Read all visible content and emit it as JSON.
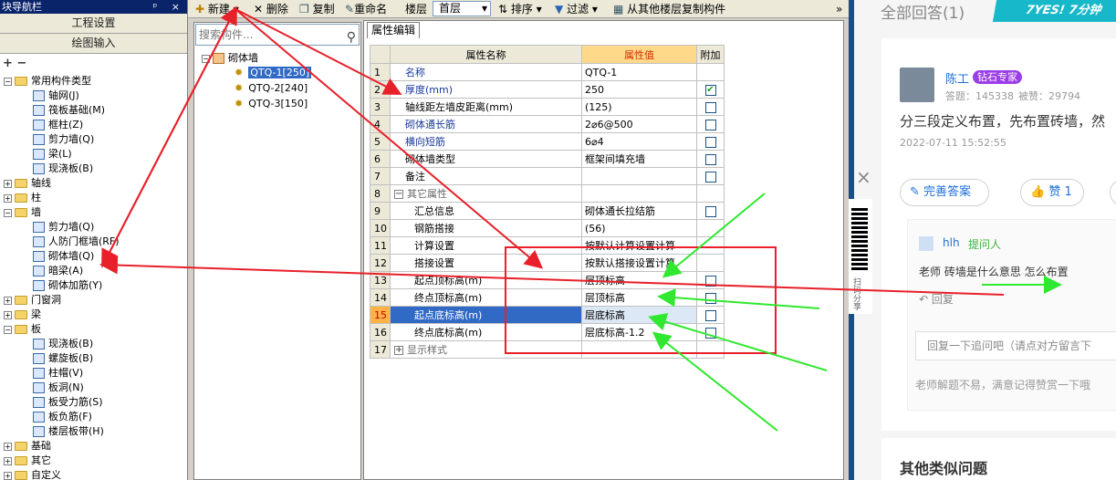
{
  "left_panel": {
    "title": "块导航栏",
    "title_buttons": "ᵖ ×",
    "mode1": "工程设置",
    "mode2": "绘图输入",
    "plusminus": "+ −",
    "tree": [
      {
        "label": "常用构件类型",
        "level": 0,
        "type": "folder",
        "exp": "−"
      },
      {
        "label": "轴网(J)",
        "level": 1,
        "type": "item"
      },
      {
        "label": "筏板基础(M)",
        "level": 1,
        "type": "item"
      },
      {
        "label": "框柱(Z)",
        "level": 1,
        "type": "item"
      },
      {
        "label": "剪力墙(Q)",
        "level": 1,
        "type": "item"
      },
      {
        "label": "梁(L)",
        "level": 1,
        "type": "item"
      },
      {
        "label": "现浇板(B)",
        "level": 1,
        "type": "item"
      },
      {
        "label": "轴线",
        "level": 0,
        "type": "folder",
        "exp": "+"
      },
      {
        "label": "柱",
        "level": 0,
        "type": "folder",
        "exp": "+"
      },
      {
        "label": "墙",
        "level": 0,
        "type": "folder",
        "exp": "−"
      },
      {
        "label": "剪力墙(Q)",
        "level": 1,
        "type": "item"
      },
      {
        "label": "人防门框墙(RF)",
        "level": 1,
        "type": "item"
      },
      {
        "label": "砌体墙(Q)",
        "level": 1,
        "type": "item"
      },
      {
        "label": "暗梁(A)",
        "level": 1,
        "type": "item"
      },
      {
        "label": "砌体加筋(Y)",
        "level": 1,
        "type": "item"
      },
      {
        "label": "门窗洞",
        "level": 0,
        "type": "folder",
        "exp": "+"
      },
      {
        "label": "梁",
        "level": 0,
        "type": "folder",
        "exp": "+"
      },
      {
        "label": "板",
        "level": 0,
        "type": "folder",
        "exp": "−"
      },
      {
        "label": "现浇板(B)",
        "level": 1,
        "type": "item"
      },
      {
        "label": "螺旋板(B)",
        "level": 1,
        "type": "item"
      },
      {
        "label": "柱帽(V)",
        "level": 1,
        "type": "item"
      },
      {
        "label": "板洞(N)",
        "level": 1,
        "type": "item"
      },
      {
        "label": "板受力筋(S)",
        "level": 1,
        "type": "item"
      },
      {
        "label": "板负筋(F)",
        "level": 1,
        "type": "item"
      },
      {
        "label": "楼层板带(H)",
        "level": 1,
        "type": "item"
      },
      {
        "label": "基础",
        "level": 0,
        "type": "folder",
        "exp": "+"
      },
      {
        "label": "其它",
        "level": 0,
        "type": "folder",
        "exp": "+"
      },
      {
        "label": "自定义",
        "level": 0,
        "type": "folder",
        "exp": "+"
      }
    ]
  },
  "toolbar": {
    "new": "新建",
    "delete": "删除",
    "copy": "复制",
    "rename": "重命名",
    "floor_label": "楼层",
    "floor_value": "首层",
    "sort": "排序",
    "filter": "过滤",
    "copy_from": "从其他楼层复制构件",
    "more": "»"
  },
  "component_list": {
    "search_placeholder": "搜索构件...",
    "root": "砌体墙",
    "items": [
      "QTQ-1[250]",
      "QTQ-2[240]",
      "QTQ-3[150]"
    ]
  },
  "props": {
    "tab": "属性编辑",
    "headers": {
      "name": "属性名称",
      "value": "属性值",
      "extra": "附加"
    },
    "rows": [
      {
        "n": "1",
        "name": "名称",
        "value": "QTQ-1",
        "cb": false,
        "blue": true
      },
      {
        "n": "2",
        "name": "厚度(mm)",
        "value": "250",
        "cb": true,
        "checked": true,
        "blue": true
      },
      {
        "n": "3",
        "name": "轴线距左墙皮距离(mm)",
        "value": "(125)",
        "cb": true
      },
      {
        "n": "4",
        "name": "砌体通长筋",
        "value": "2⌀6@500",
        "cb": true,
        "blue": true
      },
      {
        "n": "5",
        "name": "横向短筋",
        "value": "6⌀4",
        "cb": true,
        "blue": true
      },
      {
        "n": "6",
        "name": "砌体墙类型",
        "value": "框架间填充墙",
        "cb": true
      },
      {
        "n": "7",
        "name": "备注",
        "value": "",
        "cb": true
      },
      {
        "n": "8",
        "name": "其它属性",
        "value": "",
        "cb": false,
        "group": true
      },
      {
        "n": "9",
        "name": "汇总信息",
        "value": "砌体通长拉结筋",
        "cb": true,
        "indent": true
      },
      {
        "n": "10",
        "name": "钢筋搭接",
        "value": "(56)",
        "cb": false,
        "indent": true
      },
      {
        "n": "11",
        "name": "计算设置",
        "value": "按默认计算设置计算",
        "cb": false,
        "indent": true
      },
      {
        "n": "12",
        "name": "搭接设置",
        "value": "按默认搭接设置计算",
        "cb": false,
        "indent": true
      },
      {
        "n": "13",
        "name": "起点顶标高(m)",
        "value": "层顶标高",
        "cb": true,
        "indent": true
      },
      {
        "n": "14",
        "name": "终点顶标高(m)",
        "value": "层顶标高",
        "cb": true,
        "indent": true
      },
      {
        "n": "15",
        "name": "起点底标高(m)",
        "value": "层底标高",
        "cb": true,
        "indent": true,
        "selected": true
      },
      {
        "n": "16",
        "name": "终点底标高(m)",
        "value": "层底标高-1.2",
        "cb": true,
        "indent": true
      },
      {
        "n": "17",
        "name": "显示样式",
        "value": "",
        "cb": false,
        "group": true,
        "groupExp": "+"
      }
    ]
  },
  "qa": {
    "answers_title": "全部回答(1)",
    "badge": "7YES! 7分钟",
    "user": "陈工",
    "user_tag": "钻石专家",
    "answers_count": "答题：145338",
    "likes_count": "被赞：29794",
    "answer_text": "分三段定义布置，先布置砖墙，然",
    "answer_time": "2022-07-11 15:52:55",
    "improve_btn": "完善答案",
    "like_btn": "赞 1",
    "follow_user": "hlh",
    "follow_tag": "提问人",
    "follow_text": "老师 砖墙是什么意思 怎么布置",
    "reply_link": "回复",
    "reply_placeholder": "回复一下追问吧（请点对方留言下",
    "hint": "老师解题不易，满意记得赞赏一下哦",
    "similar_title": "其他类似问题",
    "close_symbol": "×",
    "share_text": "扫码分享"
  },
  "colors": {
    "annot_red": "#e8202a",
    "annot_green": "#2fe82f",
    "accent": "#1e6fd9"
  }
}
